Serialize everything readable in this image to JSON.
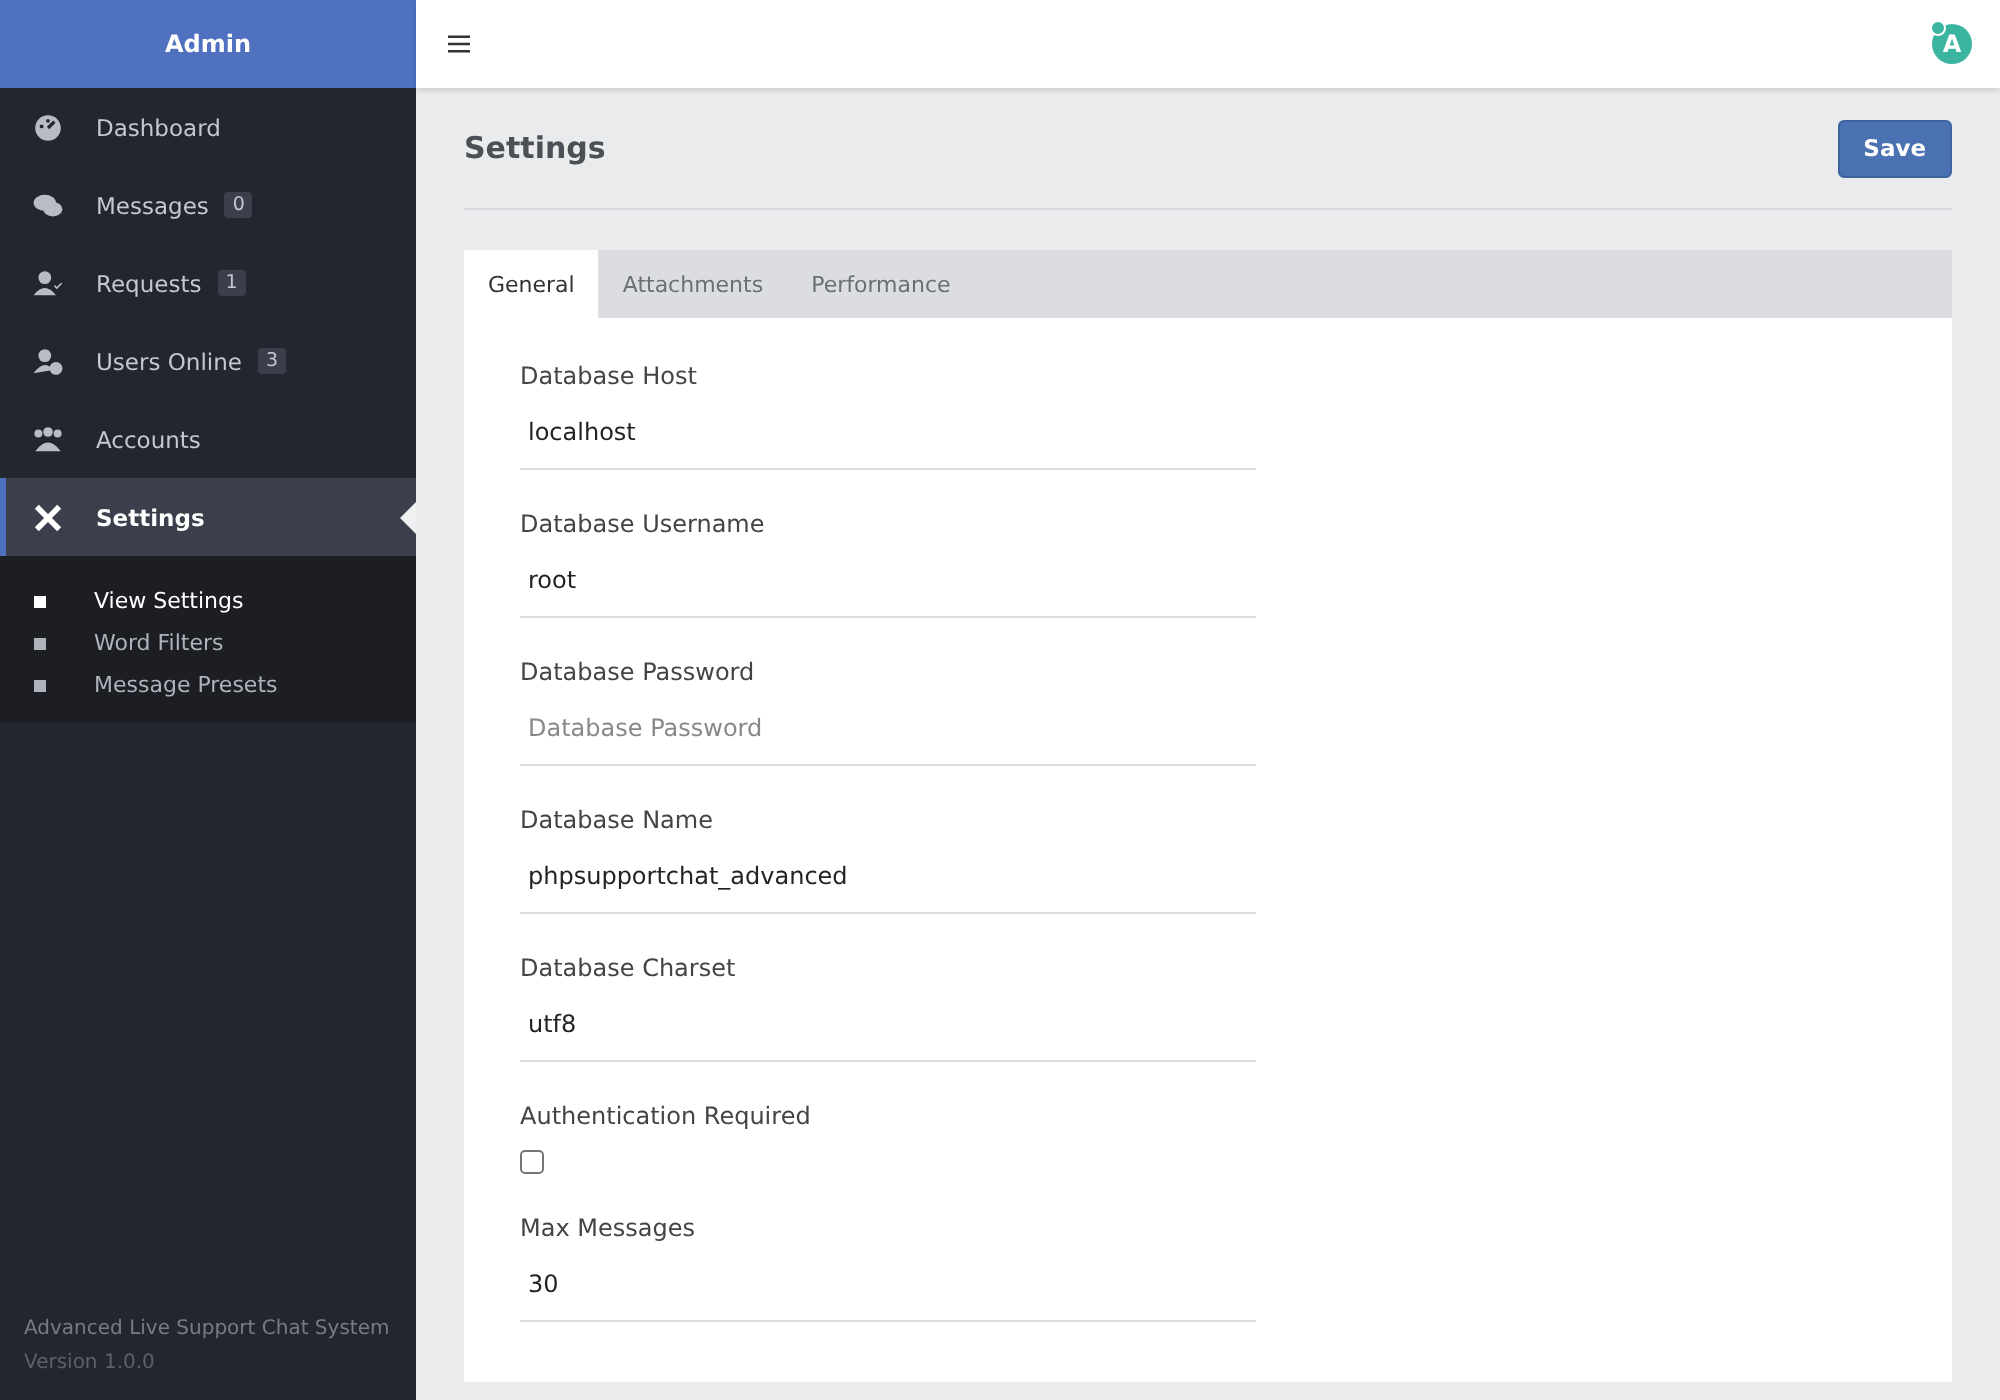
{
  "sidebar": {
    "title": "Admin",
    "items": [
      {
        "label": "Dashboard",
        "selected": false
      },
      {
        "label": "Messages",
        "count": "0",
        "selected": false
      },
      {
        "label": "Requests",
        "count": "1",
        "selected": false
      },
      {
        "label": "Users Online",
        "count": "3",
        "selected": false
      },
      {
        "label": "Accounts",
        "selected": false
      },
      {
        "label": "Settings",
        "selected": true
      }
    ],
    "submenu": [
      {
        "label": "View Settings",
        "selected": true
      },
      {
        "label": "Word Filters",
        "selected": false
      },
      {
        "label": "Message Presets",
        "selected": false
      }
    ],
    "footer": {
      "product": "Advanced Live Support Chat System",
      "version": "Version 1.0.0"
    }
  },
  "topbar": {
    "avatar": "A"
  },
  "page": {
    "title": "Settings",
    "save": "Save"
  },
  "tabs": [
    {
      "label": "General",
      "selected": true
    },
    {
      "label": "Attachments",
      "selected": false
    },
    {
      "label": "Performance",
      "selected": false
    }
  ],
  "fields": [
    {
      "kind": "text",
      "label": "Database Host",
      "value": "localhost"
    },
    {
      "kind": "text",
      "label": "Database Username",
      "value": "root"
    },
    {
      "kind": "text",
      "label": "Database Password",
      "placeholder": "Database Password"
    },
    {
      "kind": "text",
      "label": "Database Name",
      "value": "phpsupportchat_advanced"
    },
    {
      "kind": "text",
      "label": "Database Charset",
      "value": "utf8"
    },
    {
      "kind": "checkbox",
      "label": "Authentication Required",
      "checked": false
    },
    {
      "kind": "text",
      "label": "Max Messages",
      "value": "30"
    }
  ]
}
